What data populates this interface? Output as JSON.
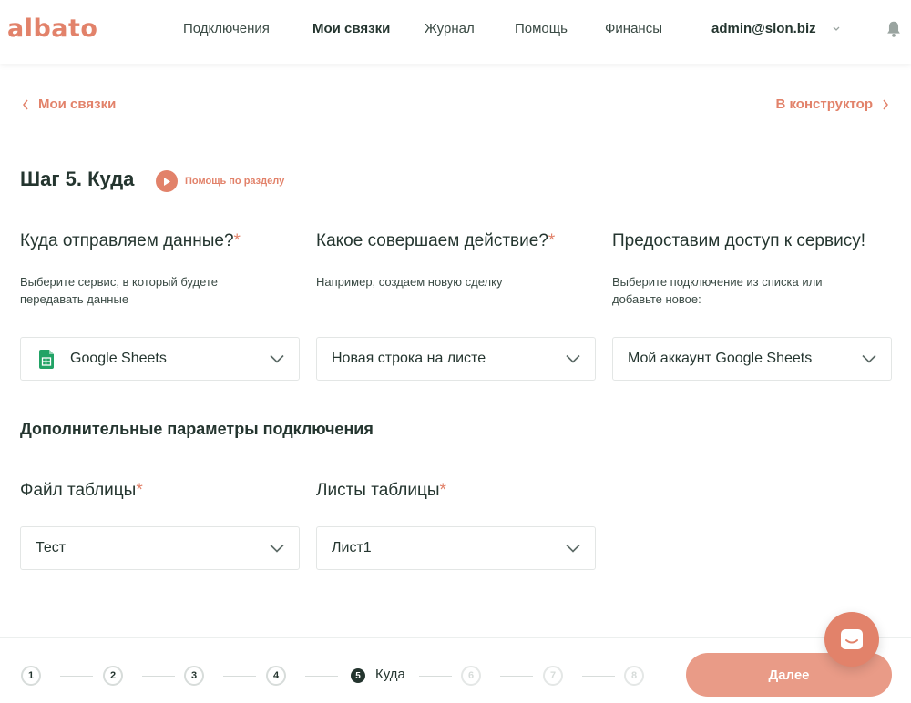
{
  "header": {
    "logo": "albato",
    "nav": [
      {
        "label": "Подключения",
        "active": false
      },
      {
        "label": "Мои связки",
        "active": true
      },
      {
        "label": "Журнал",
        "active": false
      },
      {
        "label": "Помощь",
        "active": false
      },
      {
        "label": "Финансы",
        "active": false
      }
    ],
    "user_email": "admin@slon.biz"
  },
  "subnav": {
    "back_label": "Мои связки",
    "forward_label": "В конструктор"
  },
  "step": {
    "title": "Шаг 5. Куда",
    "help_label": "Помощь по разделу"
  },
  "columns": [
    {
      "question": "Куда отправляем данные?",
      "hint": "Выберите сервис, в который будете передавать данные",
      "value": "Google Sheets",
      "icon": "google-sheets-icon"
    },
    {
      "question": "Какое совершаем действие?",
      "hint": "Например, создаем новую сделку",
      "value": "Новая строка на листе"
    },
    {
      "question": "Предоставим доступ к сервису!",
      "hint": "Выберите подключение из списка или добавьте новое:",
      "value": "Мой аккаунт Google Sheets"
    }
  ],
  "extra": {
    "title": "Дополнительные параметры подключения",
    "fields": [
      {
        "label": "Файл таблицы",
        "value": "Тест"
      },
      {
        "label": "Листы таблицы",
        "value": "Лист1"
      }
    ]
  },
  "required_mark": "*",
  "footer": {
    "steps": [
      "1",
      "2",
      "3",
      "4",
      "5",
      "6",
      "7",
      "8"
    ],
    "current_step": 5,
    "current_label": "Куда",
    "next_label": "Далее"
  },
  "colors": {
    "accent": "#e2826a",
    "button": "#e99b87",
    "text": "#24352f",
    "sheets_green": "#21a366"
  }
}
